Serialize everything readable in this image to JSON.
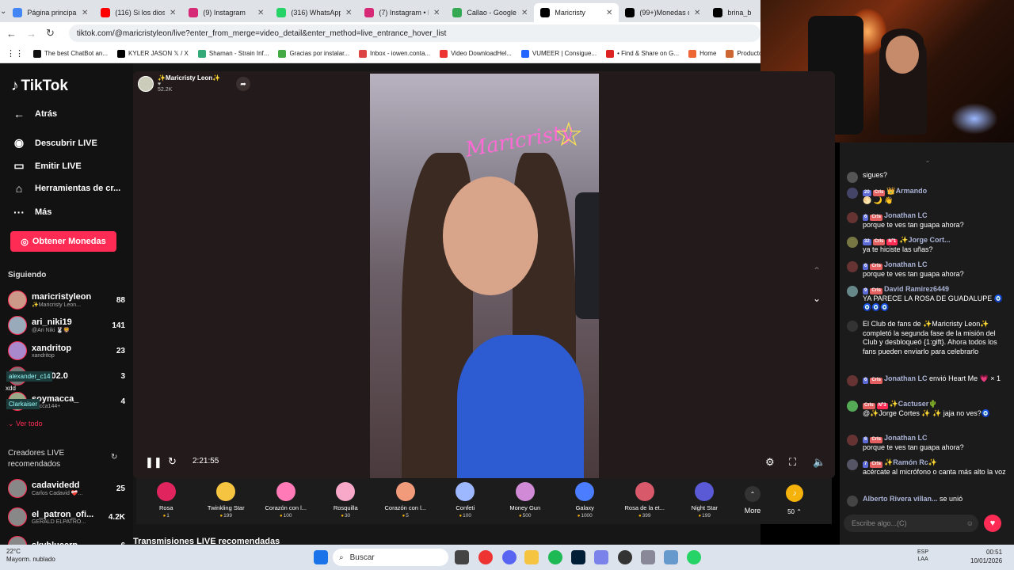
{
  "browser": {
    "tabs": [
      {
        "title": "Página principal",
        "color": "#4285f4"
      },
      {
        "title": "(116) Si los dioses",
        "color": "#ff0000"
      },
      {
        "title": "(9) Instagram",
        "color": "#d62976"
      },
      {
        "title": "(316) WhatsApp",
        "color": "#25d366"
      },
      {
        "title": "(7) Instagram • M",
        "color": "#d62976"
      },
      {
        "title": "Callao - Google M",
        "color": "#34a853"
      },
      {
        "title": "Maricristy",
        "color": "#000000"
      },
      {
        "title": "(99+)Monedas de",
        "color": "#000000"
      },
      {
        "title": "brina_b",
        "color": "#000000"
      }
    ],
    "url": "tiktok.com/@maricristyleon/live?enter_from_merge=video_detail&enter_method=live_entrance_hover_list",
    "bookmarks": [
      {
        "label": "The best ChatBot an...",
        "color": "#111"
      },
      {
        "label": "KYLER JASON 𝕏 / X",
        "color": "#000"
      },
      {
        "label": "Shaman - Strain Inf...",
        "color": "#3a7"
      },
      {
        "label": "Gracias por instalar...",
        "color": "#4a4"
      },
      {
        "label": "Inbox - iowen.conta...",
        "color": "#d44"
      },
      {
        "label": "Video DownloadHel...",
        "color": "#e33"
      },
      {
        "label": "VUMEER | Consigue...",
        "color": "#26f"
      },
      {
        "label": "• Find & Share on G...",
        "color": "#d22"
      },
      {
        "label": "Home",
        "color": "#e63"
      },
      {
        "label": "Producto: Co",
        "color": "#c63"
      }
    ]
  },
  "sidebar": {
    "logo": "TikTok",
    "nav": [
      {
        "label": "Atrás",
        "icon": "←"
      },
      {
        "label": "Descubrir LIVE",
        "icon": "◉"
      },
      {
        "label": "Emitir LIVE",
        "icon": "▭"
      },
      {
        "label": "Herramientas de cr...",
        "icon": "⌂"
      },
      {
        "label": "Más",
        "icon": "···"
      }
    ],
    "coins_button": "Obtener Monedas",
    "following_title": "Siguiendo",
    "following": [
      {
        "name": "maricristyleon",
        "sub": "✨Maricristy Leon...",
        "count": "88"
      },
      {
        "name": "ari_niki19",
        "sub": "@Ari Niki 🐰🦁",
        "count": "141"
      },
      {
        "name": "xandritop",
        "sub": "xandritop",
        "count": "23"
      },
      {
        "name": "222102.0",
        "sub": "",
        "count": "3"
      },
      {
        "name": "soymacca_",
        "sub": "macca144+",
        "count": "4"
      }
    ],
    "see_all": "Ver todo",
    "recommended_title": "Creadores LIVE recomendados",
    "recommended": [
      {
        "name": "cadavidedd",
        "sub": "Carlos Cadavid ❤️‍🩹...",
        "count": "25"
      },
      {
        "name": "el_patron_ofi...",
        "sub": "GERALD ELPATRÓ...",
        "count": "4.2K"
      },
      {
        "name": "skyblueerp",
        "sub": "",
        "count": "6"
      }
    ],
    "overlay_tags": [
      "alexander_c14",
      "xdd",
      "Clarkaiser"
    ]
  },
  "live": {
    "host_name": "✨Maricristy Leon✨",
    "host_likes": "52.2K",
    "neon_sign": "Maricristy",
    "time": "2:21:55",
    "recommended_streams": "Transmisiones LIVE recomendadas"
  },
  "gifts": [
    {
      "name": "Rosa",
      "price": "1",
      "color": "#e0245e"
    },
    {
      "name": "Twinkling Star",
      "price": "199",
      "color": "#f5c542"
    },
    {
      "name": "Corazón con l...",
      "price": "100",
      "color": "#ff7ab6"
    },
    {
      "name": "Rosquilla",
      "price": "30",
      "color": "#f8a8c8"
    },
    {
      "name": "Corazón con l...",
      "price": "5",
      "color": "#f29b7a"
    },
    {
      "name": "Confeti",
      "price": "100",
      "color": "#9db8ff"
    },
    {
      "name": "Money Gun",
      "price": "500",
      "color": "#d18bd6"
    },
    {
      "name": "Galaxy",
      "price": "1000",
      "color": "#4a7dff"
    },
    {
      "name": "Rosa de la et...",
      "price": "399",
      "color": "#d85a6a"
    },
    {
      "name": "Night Star",
      "price": "199",
      "color": "#5a5ad6"
    }
  ],
  "gift_more": "More",
  "coin_amount": "50",
  "chat": {
    "messages": [
      {
        "name": "",
        "badges": [],
        "text": "sigues?",
        "avatar": "#555"
      },
      {
        "name": "👑Armando",
        "badges": [
          "20",
          "Crls"
        ],
        "text": "🌕 🌙 👋",
        "avatar": "#446"
      },
      {
        "name": "Jonathan LC",
        "badges": [
          "6",
          "Crls"
        ],
        "text": "porque te ves tan guapa ahora?",
        "avatar": "#633"
      },
      {
        "name": "✨Jorge Cort...",
        "badges": [
          "32",
          "Crls",
          "Nº1"
        ],
        "text": "ya te hiciste las uñas?",
        "avatar": "#774"
      },
      {
        "name": "Jonathan LC",
        "badges": [
          "6",
          "Crls"
        ],
        "text": "porque te ves tan guapa ahora?",
        "avatar": "#633"
      },
      {
        "name": "David Ramirez6449",
        "badges": [
          "9",
          "Crls"
        ],
        "text": "YA PARECE LA ROSA DE GUADALUPE 🧿🧿🧿🧿",
        "avatar": "#688"
      },
      {
        "name": "",
        "badges": [],
        "text": "El Club de fans de ✨Maricristy Leon✨ completó la segunda fase de la misión del Club y desbloqueó {1:gift}. Ahora todos los fans pueden enviarlo para celebrarlo",
        "avatar": "#333"
      },
      {
        "name": "Jonathan LC",
        "badges": [
          "6",
          "Crls"
        ],
        "text": "envió Heart Me 💗 × 1",
        "avatar": "#633"
      },
      {
        "name": "✨Cactuser🌵",
        "badges": [
          "Crls",
          "Nº3"
        ],
        "text": "@✨Jorge Cortes ✨ ✨ jaja no ves?🧿",
        "avatar": "#5a5"
      },
      {
        "name": "Jonathan LC",
        "badges": [
          "6",
          "Crls"
        ],
        "text": "porque te ves tan guapa ahora?",
        "avatar": "#633"
      },
      {
        "name": "✨Ramón Rc✨",
        "badges": [
          "7",
          "Crls"
        ],
        "text": "acércate al micrófono o canta más alto la voz",
        "avatar": "#556"
      },
      {
        "name": "Alberto Rivera villan...",
        "badges": [],
        "text": "se unió",
        "avatar": "#444"
      }
    ],
    "input_placeholder": "Escribe algo...(C)"
  },
  "taskbar": {
    "temp": "22°C",
    "weather": "Mayorm. nublado",
    "search": "Buscar",
    "lang": "ESP",
    "region": "LAA",
    "time": "00:51",
    "date": "10/01/2026"
  }
}
